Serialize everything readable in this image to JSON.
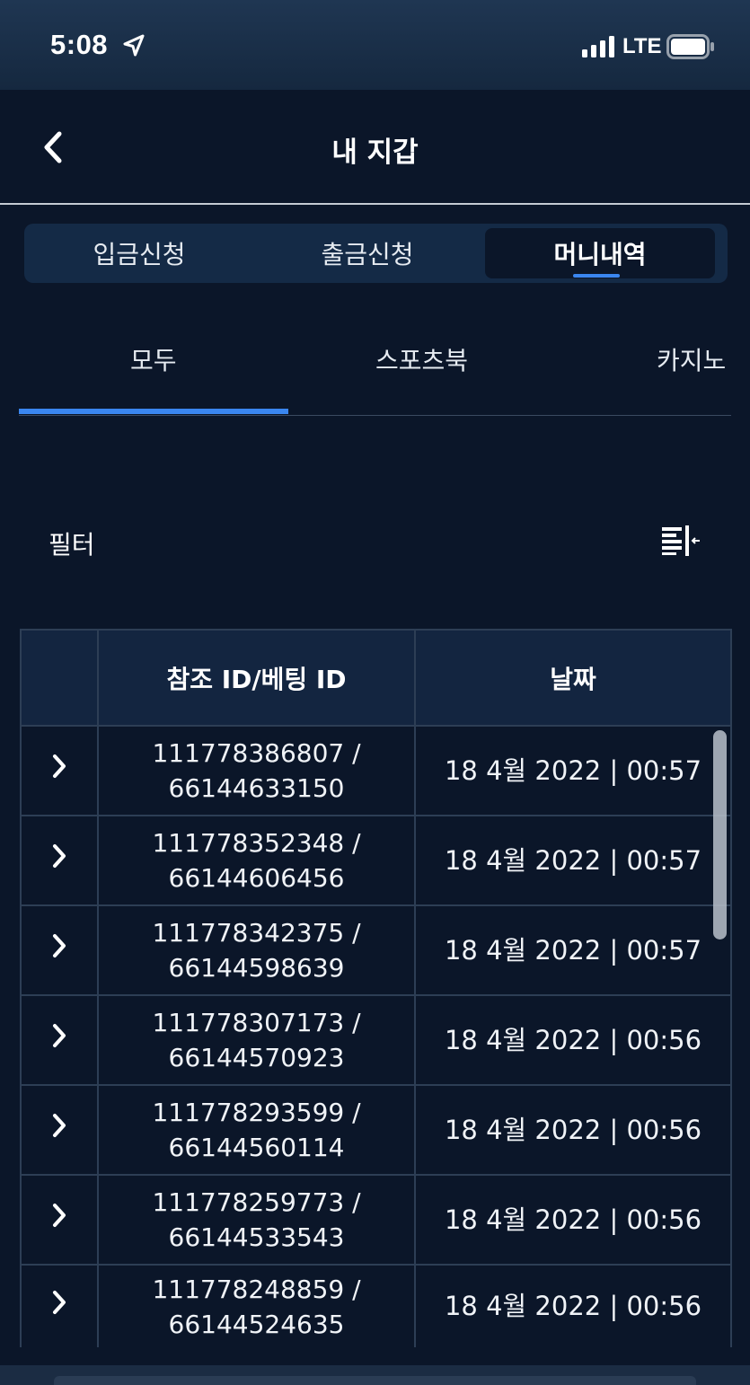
{
  "status_bar": {
    "time": "5:08",
    "network": "LTE",
    "icons": [
      "location-arrow-icon",
      "signal-bars-icon",
      "battery-icon"
    ]
  },
  "header": {
    "title": "내 지갑",
    "back_icon": "chevron-left-icon"
  },
  "segments": [
    {
      "label": "입금신청",
      "active": false
    },
    {
      "label": "출금신청",
      "active": false
    },
    {
      "label": "머니내역",
      "active": true
    }
  ],
  "subtabs": [
    {
      "label": "모두",
      "active": true
    },
    {
      "label": "스포츠북",
      "active": false
    },
    {
      "label": "카지노",
      "active": false
    }
  ],
  "filter": {
    "label": "필터",
    "icon": "filter-collapse-icon"
  },
  "table": {
    "headers": [
      "",
      "참조 ID/베팅 ID",
      "날짜"
    ],
    "rows": [
      {
        "ref_id": "111778386807 /",
        "bet_id": "66144633150",
        "date": "18 4월 2022 | 00:57"
      },
      {
        "ref_id": "111778352348 /",
        "bet_id": "66144606456",
        "date": "18 4월 2022 | 00:57"
      },
      {
        "ref_id": "111778342375 /",
        "bet_id": "66144598639",
        "date": "18 4월 2022 | 00:57"
      },
      {
        "ref_id": "111778307173 /",
        "bet_id": "66144570923",
        "date": "18 4월 2022 | 00:56"
      },
      {
        "ref_id": "111778293599 /",
        "bet_id": "66144560114",
        "date": "18 4월 2022 | 00:56"
      },
      {
        "ref_id": "111778259773 /",
        "bet_id": "66144533543",
        "date": "18 4월 2022 | 00:56"
      },
      {
        "ref_id": "111778248859 /",
        "bet_id": "66144524635",
        "date": "18 4월 2022 | 00:56"
      }
    ]
  },
  "colors": {
    "background": "#0b1629",
    "accent": "#3a86f0",
    "segment_bg": "#142a46",
    "table_header_bg": "#132540",
    "border": "#2d3e55"
  }
}
